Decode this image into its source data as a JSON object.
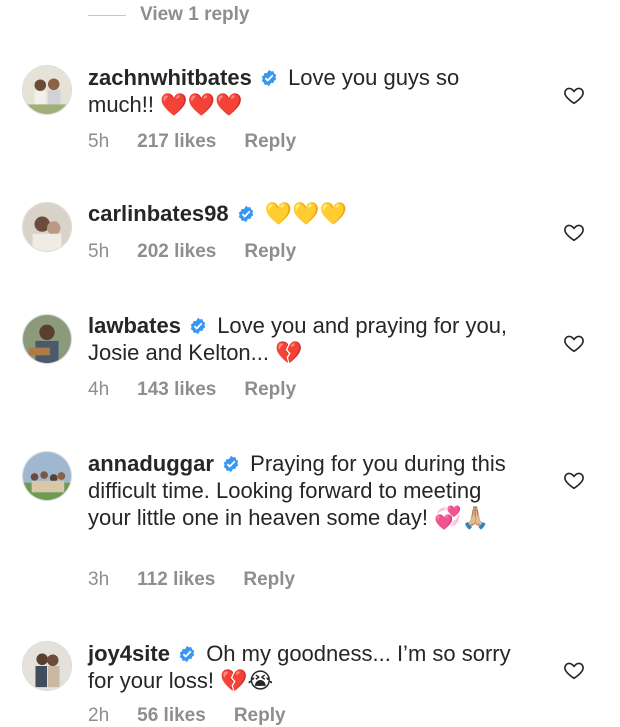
{
  "view_reply": "View 1 reply",
  "comments": [
    {
      "username": "zachnwhitbates",
      "text": "Love you guys so much!!",
      "emoji": "❤️❤️❤️",
      "time": "5h",
      "likes": "217 likes",
      "reply": "Reply"
    },
    {
      "username": "carlinbates98",
      "text": "",
      "emoji": "💛💛💛",
      "time": "5h",
      "likes": "202 likes",
      "reply": "Reply"
    },
    {
      "username": "lawbates",
      "text": "Love you and praying for you, Josie and Kelton...",
      "emoji": "💔",
      "time": "4h",
      "likes": "143 likes",
      "reply": "Reply"
    },
    {
      "username": "annaduggar",
      "text": "Praying for you during this difficult time. Looking forward to meeting your little one in heaven some day!",
      "emoji": "💞🙏🏼",
      "time": "3h",
      "likes": "112 likes",
      "reply": "Reply"
    },
    {
      "username": "joy4site",
      "text": "Oh my goodness... I’m so sorry for your loss!",
      "emoji": "💔😭",
      "time": "2h",
      "likes": "56 likes",
      "reply": "Reply"
    }
  ]
}
